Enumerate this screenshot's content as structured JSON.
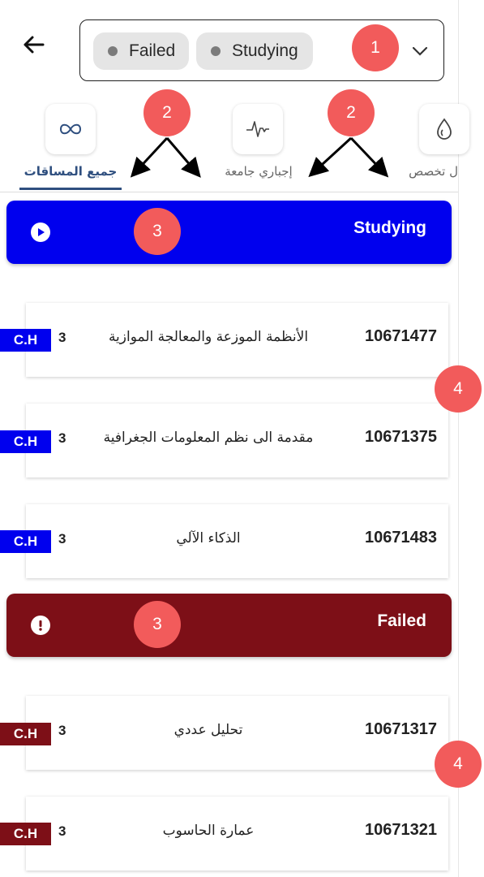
{
  "colors": {
    "studying": "#0000ee",
    "failed": "#7d0f17",
    "badge": "#f25b5b",
    "tab_active": "#2f4f7f"
  },
  "header": {
    "back_icon": "arrow-left-icon",
    "filter": {
      "chips": [
        "Failed",
        "Studying"
      ],
      "dropdown_icon": "chevron-down-icon"
    }
  },
  "tabs": [
    {
      "label": "جميع المساقات",
      "icon": "infinity-icon",
      "active": true
    },
    {
      "label": "إجباري جامعة",
      "icon": "pulse-icon",
      "active": false
    },
    {
      "label": "ل تخصص",
      "icon": "drop-icon",
      "active": false
    }
  ],
  "annotations": {
    "filter": "1",
    "tabs": [
      "2",
      "2"
    ],
    "sections": [
      "3",
      "3"
    ],
    "cards": [
      "4",
      "4"
    ]
  },
  "sections": [
    {
      "title": "Studying",
      "icon": "play-circle-icon",
      "courses": [
        {
          "code": "10671477",
          "name": "الأنظمة الموزعة والمعالجة الموازية",
          "hours": "3",
          "tag": "C.H"
        },
        {
          "code": "10671375",
          "name": "مقدمة الى نظم المعلومات الجغرافية",
          "hours": "3",
          "tag": "C.H"
        },
        {
          "code": "10671483",
          "name": "الذكاء الآلي",
          "hours": "3",
          "tag": "C.H"
        }
      ]
    },
    {
      "title": "Failed",
      "icon": "alert-circle-icon",
      "courses": [
        {
          "code": "10671317",
          "name": "تحليل عددي",
          "hours": "3",
          "tag": "C.H"
        },
        {
          "code": "10671321",
          "name": "عمارة الحاسوب",
          "hours": "3",
          "tag": "C.H"
        }
      ]
    }
  ]
}
